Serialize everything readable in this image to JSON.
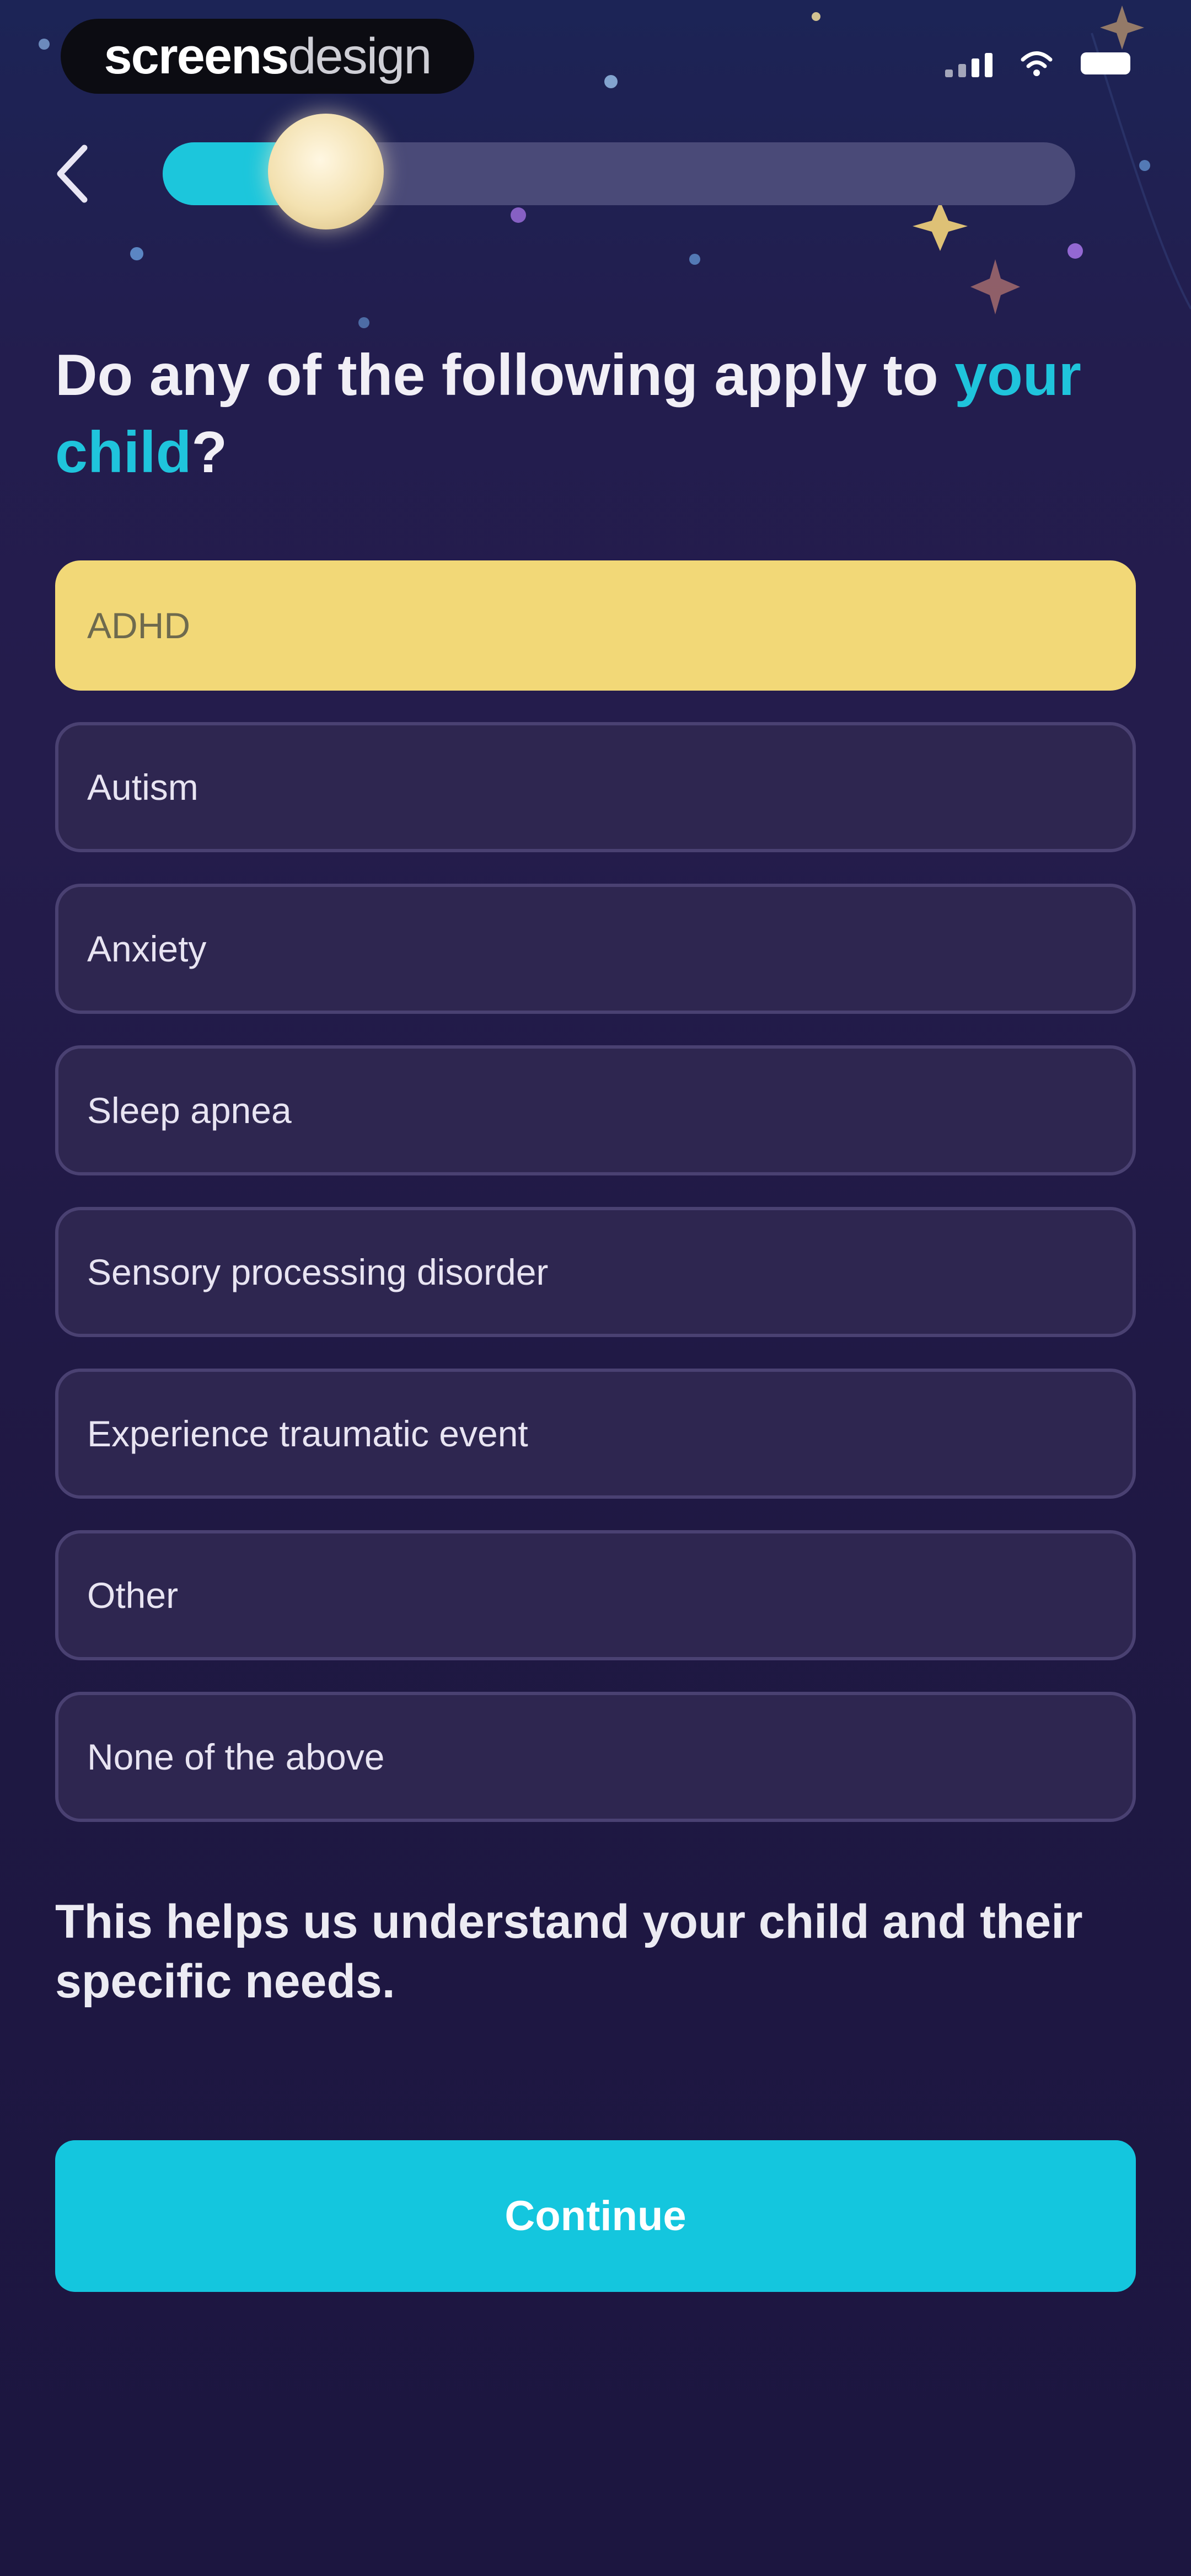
{
  "watermark": {
    "bold": "screens",
    "light": "design"
  },
  "progress": {
    "value": 0.17
  },
  "question": {
    "text_before": "Do any of the following apply to ",
    "accent": "your child",
    "text_after": "?"
  },
  "options": [
    {
      "label": "ADHD",
      "selected": true
    },
    {
      "label": "Autism",
      "selected": false
    },
    {
      "label": "Anxiety",
      "selected": false
    },
    {
      "label": "Sleep apnea",
      "selected": false
    },
    {
      "label": "Sensory processing disorder",
      "selected": false
    },
    {
      "label": "Experience traumatic event",
      "selected": false
    },
    {
      "label": "Other",
      "selected": false
    },
    {
      "label": "None of the above",
      "selected": false
    }
  ],
  "helper_text": "This helps us understand your child and their specific needs.",
  "continue_label": "Continue",
  "colors": {
    "accent": "#1fc4dc",
    "selected": "#f2d877",
    "background": "#1f1843"
  },
  "icons": {
    "back": "chevron-left-icon",
    "signal": "signal-icon",
    "wifi": "wifi-icon",
    "battery": "battery-icon"
  }
}
